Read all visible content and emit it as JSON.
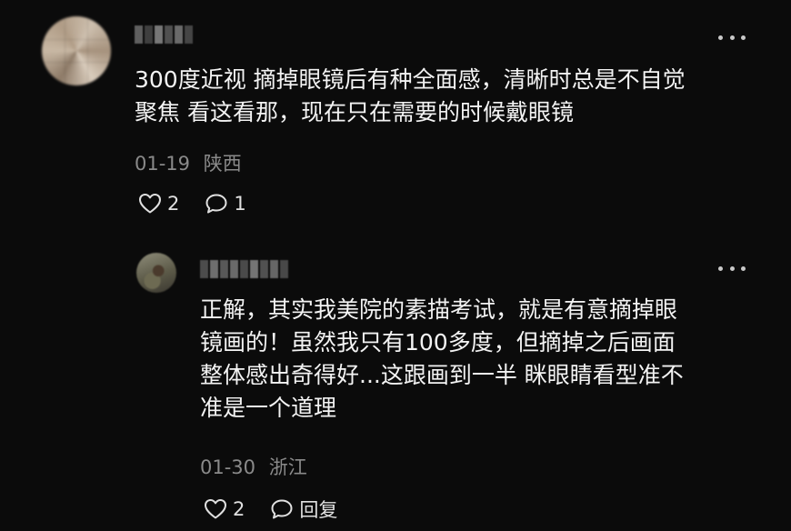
{
  "comment": {
    "text": "300度近视 摘掉眼镜后有种全面感，清晰时总是不自觉\n聚焦 看这看那，现在只在需要的时候戴眼镜",
    "date": "01-19",
    "location": "陕西",
    "like_count": "2",
    "reply_count": "1",
    "icons": [
      "heart-icon",
      "comment-icon",
      "more-icon"
    ]
  },
  "reply": {
    "text": "正解，其实我美院的素描考试，就是有意摘掉眼\n镜画的！虽然我只有100多度，但摘掉之后画面\n整体感出奇得好...这跟画到一半 眯眼睛看型准不\n准是一个道理",
    "date": "01-30",
    "location": "浙江",
    "like_count": "2",
    "reply_label": "回复",
    "icons": [
      "heart-icon",
      "comment-icon",
      "more-icon"
    ]
  },
  "colors": {
    "background": "#0b0b0b",
    "text": "#f3f3f3",
    "meta": "#8a8a8a"
  }
}
